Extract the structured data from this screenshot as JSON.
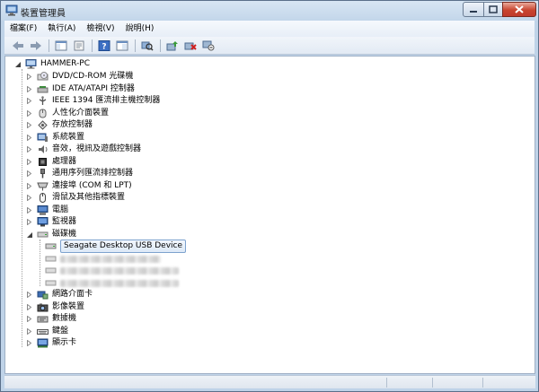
{
  "window": {
    "title": "裝置管理員"
  },
  "menu": [
    "檔案(F)",
    "執行(A)",
    "檢視(V)",
    "說明(H)"
  ],
  "toolbar": {
    "buttons": [
      "back-icon",
      "forward-icon",
      "console-tree-icon",
      "properties-icon",
      "help-icon",
      "view-icon",
      "scan-hardware-icon",
      "update-driver-icon",
      "uninstall-icon",
      "disable-icon"
    ]
  },
  "tree": {
    "root": "HAMMER-PC",
    "categories": [
      {
        "label": "DVD/CD-ROM 光碟機",
        "icon": "optical-drive-icon"
      },
      {
        "label": "IDE ATA/ATAPI 控制器",
        "icon": "ide-controller-icon"
      },
      {
        "label": "IEEE 1394 匯流排主機控制器",
        "icon": "ieee1394-icon"
      },
      {
        "label": "人性化介面裝置",
        "icon": "hid-icon"
      },
      {
        "label": "存放控制器",
        "icon": "storage-controller-icon"
      },
      {
        "label": "系統裝置",
        "icon": "system-device-icon"
      },
      {
        "label": "音效，視訊及遊戲控制器",
        "icon": "sound-icon"
      },
      {
        "label": "處理器",
        "icon": "processor-icon"
      },
      {
        "label": "通用序列匯流排控制器",
        "icon": "usb-controller-icon"
      },
      {
        "label": "連接埠 (COM 和 LPT)",
        "icon": "port-icon"
      },
      {
        "label": "滑鼠及其他指標裝置",
        "icon": "mouse-icon"
      },
      {
        "label": "電腦",
        "icon": "computer-icon"
      },
      {
        "label": "監視器",
        "icon": "monitor-icon"
      }
    ],
    "disk_drives": {
      "label": "磁碟機",
      "children": [
        "Seagate Desktop USB Device"
      ]
    },
    "categories_after": [
      {
        "label": "網路介面卡",
        "icon": "network-adapter-icon"
      },
      {
        "label": "影像裝置",
        "icon": "imaging-device-icon"
      },
      {
        "label": "數據機",
        "icon": "modem-icon"
      },
      {
        "label": "鍵盤",
        "icon": "keyboard-icon"
      },
      {
        "label": "顯示卡",
        "icon": "display-adapter-icon"
      }
    ]
  }
}
